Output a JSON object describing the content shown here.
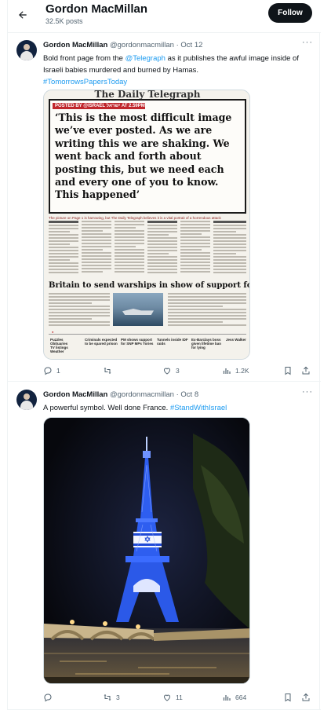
{
  "header": {
    "name": "Gordon MacMillan",
    "post_count": "32.5K posts",
    "follow_label": "Follow"
  },
  "tweets": [
    {
      "name": "Gordon MacMillan",
      "handle": "@gordonmacmillan",
      "dot": "·",
      "date": "Oct 12",
      "text_before": "Bold front page from the ",
      "mention": "@Telegraph",
      "text_after": " as it publishes the awful image inside of Israeli babies murdered and burned by Hamas.",
      "hashtag": "#TomorrowsPapersToday",
      "image": {
        "masthead": "The Daily Telegraph",
        "quote_bar": "POSTED BY @ISRAEL  ישראל  AT 2.59PM",
        "quote": "‘This is the most difficult image we’ve ever posted. As we are writing this we are shaking. We went back and forth about posting this, but we need each and every one of you to know. This happened’",
        "caption": "The picture on Page 1 is harrowing, but The Daily Telegraph believes it is a vital portrait of a horrendous attack",
        "headline": "Britain to send warships in show of support for Israel",
        "bottom_items": [
          "Puzzles",
          "Obituaries",
          "TV listings",
          "Weather"
        ],
        "bottom_heads": [
          "Criminals expected to be spared prison",
          "PM shows support for SNP MPs Tories",
          "Tunnels inside IDF raids",
          "Ex-Barclays boss given lifetime ban for lying",
          "Jess Walker"
        ]
      },
      "stats": {
        "replies": "1",
        "reposts": "",
        "likes": "3",
        "views": "1.2K"
      }
    },
    {
      "name": "Gordon MacMillan",
      "handle": "@gordonmacmillan",
      "dot": "·",
      "date": "Oct 8",
      "text_before": "A powerful symbol. Well done France. ",
      "hashtag": "#StandWithIsrael",
      "stats": {
        "replies": "",
        "reposts": "3",
        "likes": "11",
        "views": "664"
      }
    }
  ],
  "colors": {
    "accent": "#1d9bf0",
    "text": "#0f1419",
    "muted": "#536471",
    "border": "#eff3f4",
    "telegraph_red": "#c0272d",
    "tower_blue": "#2b59e8"
  },
  "icons": [
    "back-arrow-icon",
    "more-icon",
    "reply-icon",
    "repost-icon",
    "like-icon",
    "views-icon",
    "bookmark-icon",
    "share-icon"
  ]
}
